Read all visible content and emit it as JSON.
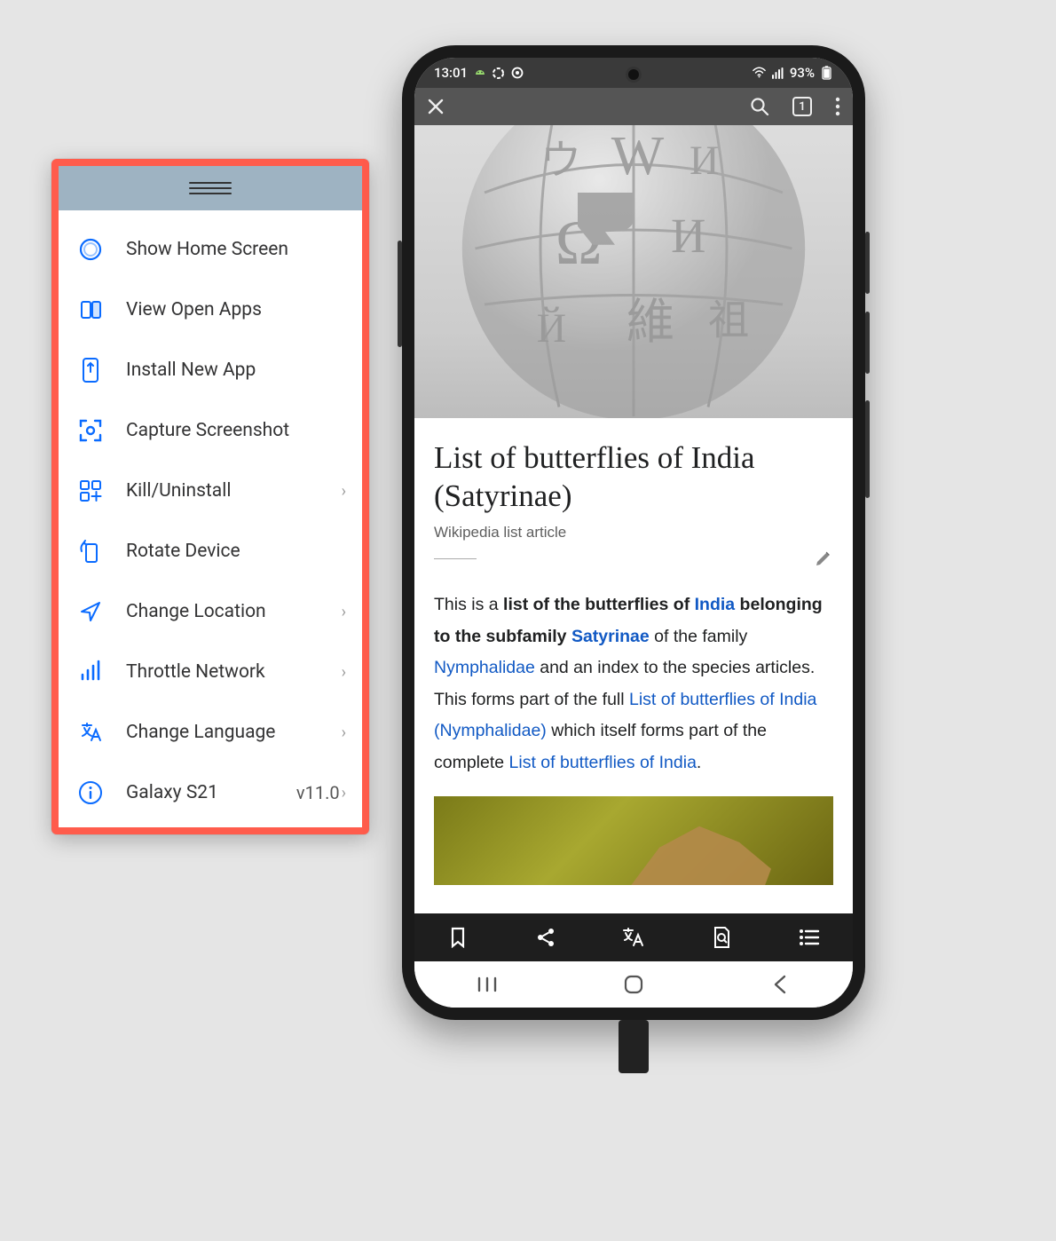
{
  "control_panel": {
    "items": [
      {
        "label": "Show Home Screen",
        "icon": "home-circle",
        "chevron": false
      },
      {
        "label": "View Open Apps",
        "icon": "open-apps",
        "chevron": false
      },
      {
        "label": "Install New App",
        "icon": "install",
        "chevron": false
      },
      {
        "label": "Capture Screenshot",
        "icon": "capture",
        "chevron": false
      },
      {
        "label": "Kill/Uninstall",
        "icon": "apps-grid",
        "chevron": true
      },
      {
        "label": "Rotate Device",
        "icon": "rotate",
        "chevron": false
      },
      {
        "label": "Change Location",
        "icon": "location",
        "chevron": true
      },
      {
        "label": "Throttle Network",
        "icon": "network",
        "chevron": true
      },
      {
        "label": "Change Language",
        "icon": "language",
        "chevron": true
      },
      {
        "label": "Galaxy S21",
        "icon": "info",
        "chevron": true,
        "version": "v11.0"
      }
    ]
  },
  "phone": {
    "status": {
      "time": "13:01",
      "battery": "93%"
    },
    "browser_tabs": "1",
    "article": {
      "title": "List of butterflies of India (Satyrinae)",
      "subtitle": "Wikipedia list article",
      "p1_a": "This is a ",
      "p1_b": "list of the butterflies of ",
      "p1_link1": "India",
      "p1_c": " belonging to the subfamily ",
      "p1_link2": "Satyrinae",
      "p1_d": " of the family ",
      "p1_link3": "Nymphalidae",
      "p1_e": " and an index to the species articles. This forms part of the full ",
      "p1_link4": "List of butterflies of India (Nymphalidae)",
      "p1_f": " which itself forms part of the complete ",
      "p1_link5": "List of butterflies of India",
      "p1_g": "."
    }
  }
}
